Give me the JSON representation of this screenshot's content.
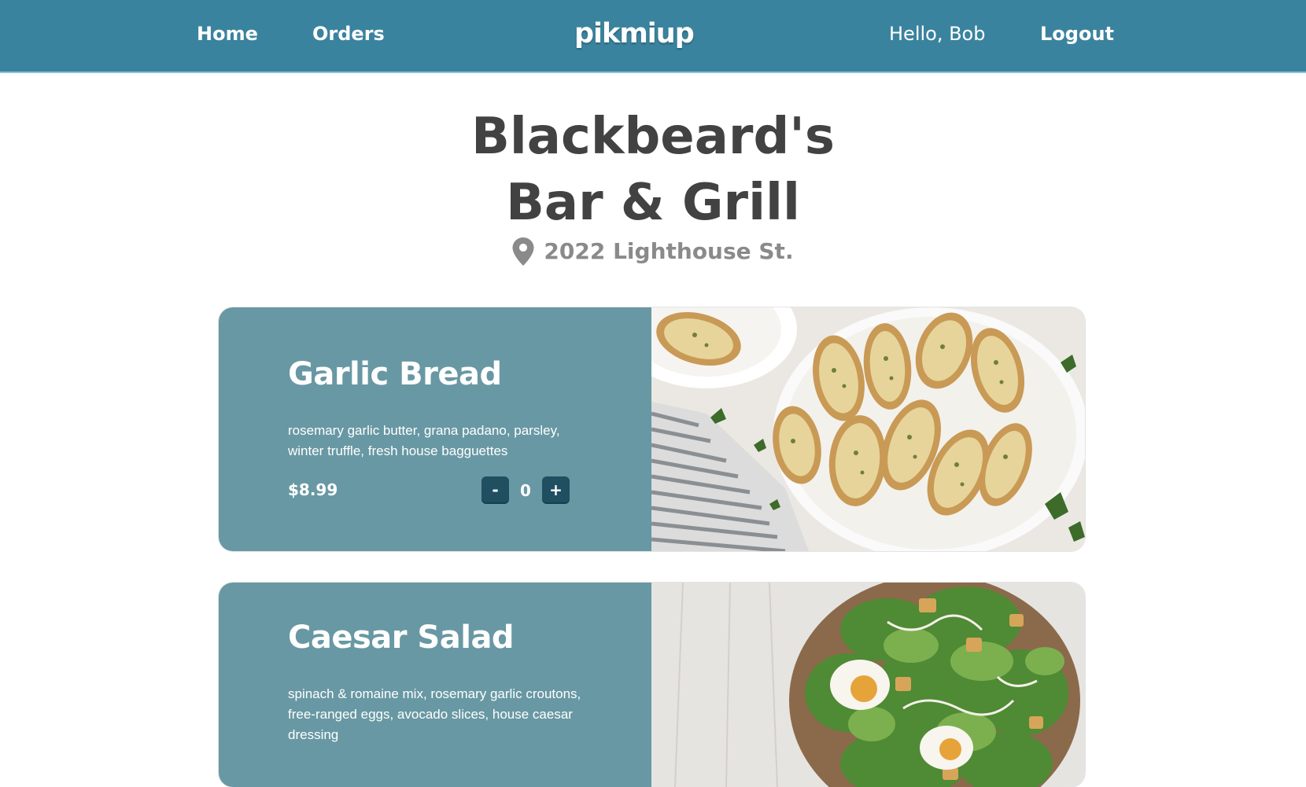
{
  "nav": {
    "home_label": "Home",
    "orders_label": "Orders",
    "brand": "pikmiup",
    "greeting": "Hello, Bob",
    "logout_label": "Logout"
  },
  "restaurant": {
    "name_line1": "Blackbeard's",
    "name_line2": "Bar & Grill",
    "address": "2022 Lighthouse St."
  },
  "menu": {
    "items": [
      {
        "name": "Garlic Bread",
        "description": "rosemary garlic butter, grana padano, parsley, winter truffle, fresh house bagguettes",
        "price": "$8.99",
        "quantity": "0",
        "decrement_label": "-",
        "increment_label": "+"
      },
      {
        "name": "Caesar Salad",
        "description": "spinach & romaine mix, rosemary garlic croutons, free-ranged eggs, avocado slices, house caesar dressing"
      }
    ]
  },
  "colors": {
    "navbar": "#3a839f",
    "card_panel": "#6898a3",
    "stepper_button": "#1f4f60",
    "title_text": "#424242",
    "address_text": "#8a8a8a"
  },
  "icons": {
    "address": "map-pin-icon"
  }
}
